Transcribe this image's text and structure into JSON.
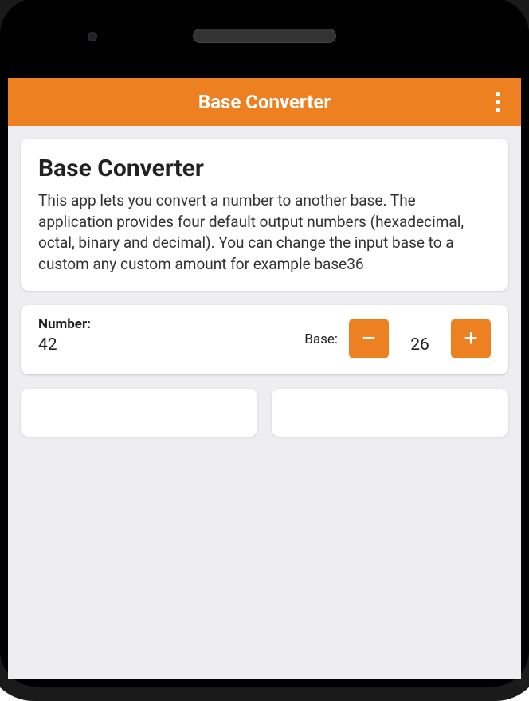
{
  "appBar": {
    "title": "Base Converter"
  },
  "intro": {
    "heading": "Base Converter",
    "description": "This app lets you convert a number to another base. The application provides four default output numbers (hexadecimal, octal, binary and decimal). You can change the input base to a custom any custom amount for example base36"
  },
  "input": {
    "numberLabel": "Number:",
    "numberValue": "42",
    "baseLabel": "Base:",
    "baseValue": "26",
    "minusLabel": "−",
    "plusLabel": "+"
  }
}
